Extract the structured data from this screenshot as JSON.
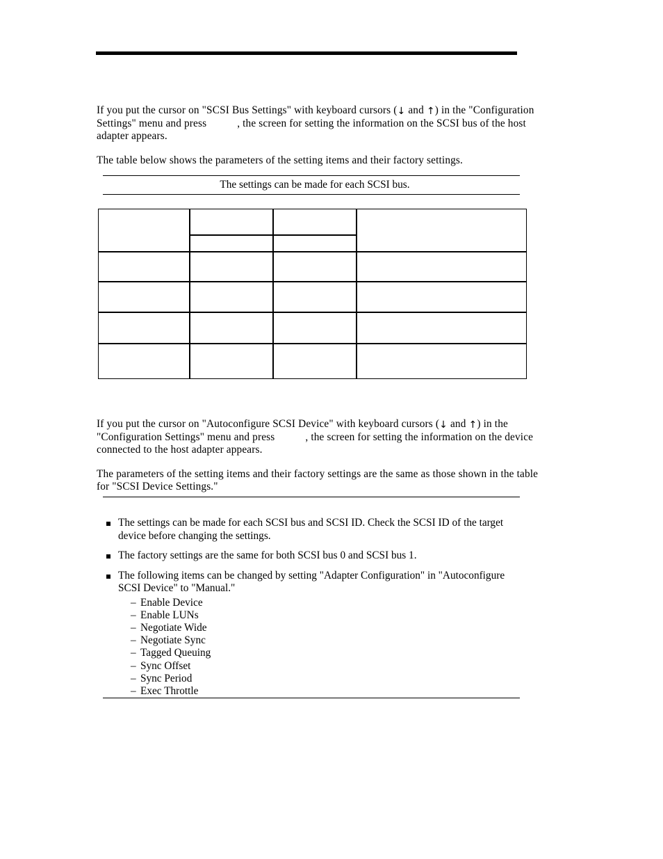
{
  "page": {
    "background_color": "#ffffff",
    "text_color": "#000000",
    "rule_color": "#000000"
  },
  "section_scsi_bus_settings": {
    "paragraphs": [
      {
        "id": "intro",
        "part1": "If you put the cursor on \"SCSI Bus Settings\" with keyboard cursors (",
        "arrow_down": "↓",
        "between_arrows": " and ",
        "arrow_up": "↑",
        "part2": ") in the \"Configuration Settings\" menu and press",
        "part3": ", the screen for setting the information on the SCSI bus of the host adapter appears."
      },
      {
        "id": "table-intro",
        "text": "The table below shows the parameters of the setting items and their factory settings."
      }
    ],
    "note": {
      "text": "The settings can be made for each SCSI bus."
    },
    "table": {
      "columns": [
        "",
        "",
        "",
        ""
      ],
      "rows": [
        [
          "",
          "",
          "",
          ""
        ],
        [
          "",
          "",
          "",
          ""
        ],
        [
          "",
          "",
          "",
          ""
        ],
        [
          "",
          "",
          "",
          ""
        ]
      ],
      "header_merged_label": "",
      "note": "empty table - no visible cell text"
    }
  },
  "section_autoconfigure_scsi_device": {
    "paragraphs": [
      {
        "id": "intro",
        "part1": "If you put the cursor on \"Autoconfigure SCSI Device\" with keyboard cursors (",
        "arrow_down": "↓",
        "between_arrows": " and ",
        "arrow_up": "↑",
        "part2": ") in the \"Configuration Settings\" menu and press",
        "part3": ", the screen for setting the information on the device connected to the host adapter appears."
      },
      {
        "id": "params",
        "text": "The parameters of the setting items and their factory settings are the same as those shown in the table for \"SCSI Device Settings.\""
      }
    ],
    "note": {
      "bullets": [
        {
          "text": "The settings can be made for each SCSI bus and SCSI ID. Check the SCSI ID of the target device before changing the settings."
        },
        {
          "text": "The factory settings are the same for both SCSI bus 0 and SCSI bus 1."
        },
        {
          "text": "The following items can be changed by setting \"Adapter Configuration\" in \"Autoconfigure SCSI Device\" to \"Manual.\"",
          "subitems": [
            "Enable Device",
            "Enable LUNs",
            "Negotiate Wide",
            "Negotiate Sync",
            "Tagged Queuing",
            "Sync Offset",
            "Sync Period",
            "Exec Throttle"
          ]
        }
      ],
      "dash": "–"
    }
  }
}
